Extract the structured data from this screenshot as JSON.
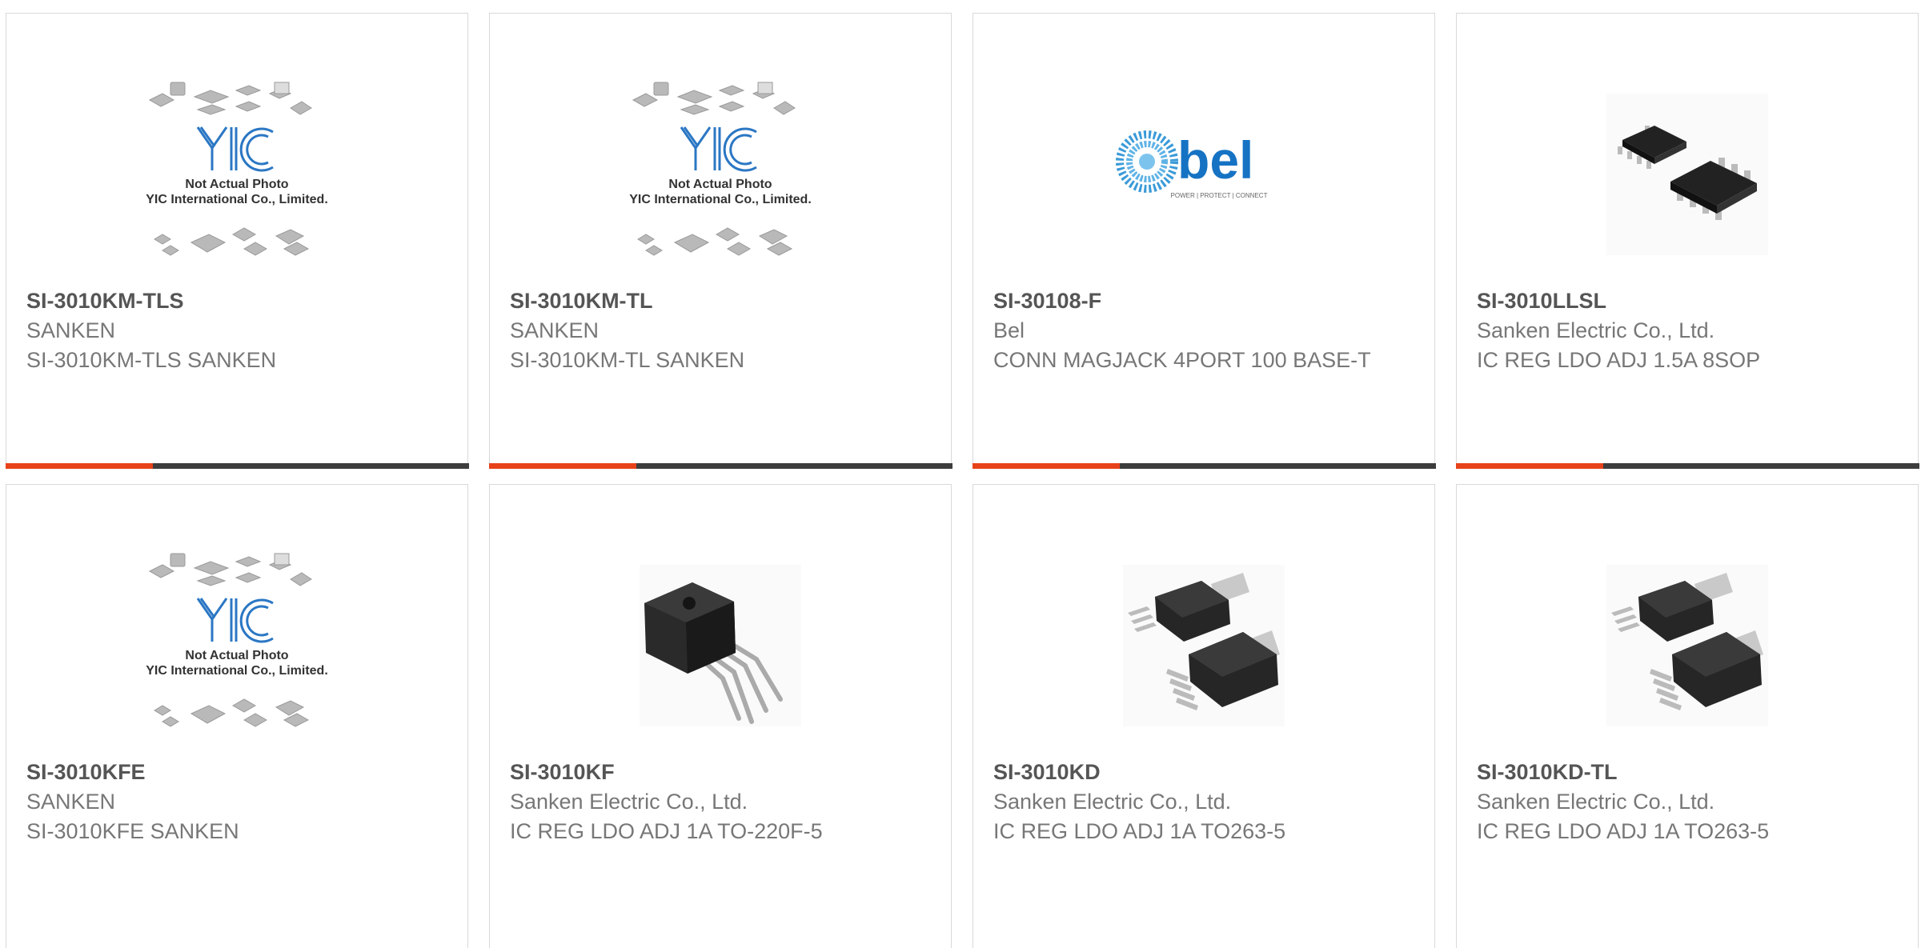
{
  "accent_color": "#e8421b",
  "products": [
    {
      "part_number": "SI-3010KM-TLS",
      "manufacturer": "SANKEN",
      "description": "SI-3010KM-TLS SANKEN",
      "image": "yic-placeholder-icon",
      "placeholder_line1": "Not Actual Photo",
      "placeholder_line2": "YIC International Co., Limited."
    },
    {
      "part_number": "SI-3010KM-TL",
      "manufacturer": "SANKEN",
      "description": "SI-3010KM-TL SANKEN",
      "image": "yic-placeholder-icon",
      "placeholder_line1": "Not Actual Photo",
      "placeholder_line2": "YIC International Co., Limited."
    },
    {
      "part_number": "SI-30108-F",
      "manufacturer": "Bel",
      "description": "CONN MAGJACK 4PORT 100 BASE-T",
      "image": "bel-logo",
      "logo_text": "bel",
      "logo_tagline": "POWER | PROTECT | CONNECT"
    },
    {
      "part_number": "SI-3010LLSL",
      "manufacturer": "Sanken Electric Co., Ltd.",
      "description": "IC REG LDO ADJ 1.5A 8SOP",
      "image": "sop8-chip-photo"
    },
    {
      "part_number": "SI-3010KFE",
      "manufacturer": "SANKEN",
      "description": "SI-3010KFE SANKEN",
      "image": "yic-placeholder-icon",
      "placeholder_line1": "Not Actual Photo",
      "placeholder_line2": "YIC International Co., Limited."
    },
    {
      "part_number": "SI-3010KF",
      "manufacturer": "Sanken Electric Co., Ltd.",
      "description": "IC REG LDO ADJ 1A TO-220F-5",
      "image": "to220-chip-photo"
    },
    {
      "part_number": "SI-3010KD",
      "manufacturer": "Sanken Electric Co., Ltd.",
      "description": "IC REG LDO ADJ 1A TO263-5",
      "image": "to263-chip-photo"
    },
    {
      "part_number": "SI-3010KD-TL",
      "manufacturer": "Sanken Electric Co., Ltd.",
      "description": "IC REG LDO ADJ 1A TO263-5",
      "image": "to263-chip-photo"
    }
  ]
}
